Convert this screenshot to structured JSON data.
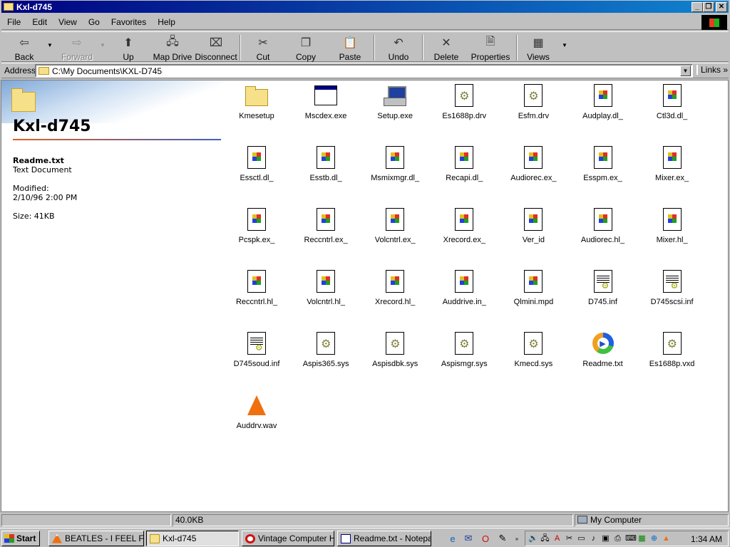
{
  "window": {
    "title": "Kxl-d745"
  },
  "menu": [
    {
      "label": "File",
      "key": "F"
    },
    {
      "label": "Edit",
      "key": "E"
    },
    {
      "label": "View",
      "key": "V"
    },
    {
      "label": "Go",
      "key": "G"
    },
    {
      "label": "Favorites",
      "key": "a"
    },
    {
      "label": "Help",
      "key": "H"
    }
  ],
  "toolbar": {
    "back": "Back",
    "forward": "Forward",
    "up": "Up",
    "map_drive": "Map Drive",
    "disconnect": "Disconnect",
    "cut": "Cut",
    "copy": "Copy",
    "paste": "Paste",
    "undo": "Undo",
    "delete": "Delete",
    "properties": "Properties",
    "views": "Views"
  },
  "address": {
    "label": "Address",
    "value": "C:\\My Documents\\KXL-D745",
    "links": "Links"
  },
  "sidebar": {
    "folder_title": "Kxl-d745",
    "file_name": "Readme.txt",
    "file_type": "Text Document",
    "modified_label": "Modified:",
    "modified_value": "2/10/96 2:00 PM",
    "size": "Size: 41KB"
  },
  "files": [
    {
      "name": "Kmesetup",
      "icon": "folder-icon"
    },
    {
      "name": "Mscdex.exe",
      "icon": "exe-window-icon"
    },
    {
      "name": "Setup.exe",
      "icon": "setup-computer-icon"
    },
    {
      "name": "Es1688p.drv",
      "icon": "system-file-icon"
    },
    {
      "name": "Esfm.drv",
      "icon": "system-file-icon"
    },
    {
      "name": "Audplay.dl_",
      "icon": "windows-file-icon"
    },
    {
      "name": "Ctl3d.dl_",
      "icon": "windows-file-icon"
    },
    {
      "name": "Essctl.dl_",
      "icon": "windows-file-icon"
    },
    {
      "name": "Esstb.dl_",
      "icon": "windows-file-icon"
    },
    {
      "name": "Msmixmgr.dl_",
      "icon": "windows-file-icon"
    },
    {
      "name": "Recapi.dl_",
      "icon": "windows-file-icon"
    },
    {
      "name": "Audiorec.ex_",
      "icon": "windows-file-icon"
    },
    {
      "name": "Esspm.ex_",
      "icon": "windows-file-icon"
    },
    {
      "name": "Mixer.ex_",
      "icon": "windows-file-icon"
    },
    {
      "name": "Pcspk.ex_",
      "icon": "windows-file-icon"
    },
    {
      "name": "Reccntrl.ex_",
      "icon": "windows-file-icon"
    },
    {
      "name": "Volcntrl.ex_",
      "icon": "windows-file-icon"
    },
    {
      "name": "Xrecord.ex_",
      "icon": "windows-file-icon"
    },
    {
      "name": "Ver_id",
      "icon": "windows-file-icon"
    },
    {
      "name": "Audiorec.hl_",
      "icon": "windows-file-icon"
    },
    {
      "name": "Mixer.hl_",
      "icon": "windows-file-icon"
    },
    {
      "name": "Reccntrl.hl_",
      "icon": "windows-file-icon"
    },
    {
      "name": "Volcntrl.hl_",
      "icon": "windows-file-icon"
    },
    {
      "name": "Xrecord.hl_",
      "icon": "windows-file-icon"
    },
    {
      "name": "Auddrive.in_",
      "icon": "windows-file-icon"
    },
    {
      "name": "Qlmini.mpd",
      "icon": "windows-file-icon"
    },
    {
      "name": "D745.inf",
      "icon": "setup-info-icon"
    },
    {
      "name": "D745scsi.inf",
      "icon": "setup-info-icon"
    },
    {
      "name": "D745soud.inf",
      "icon": "setup-info-icon"
    },
    {
      "name": "Aspis365.sys",
      "icon": "system-file-icon"
    },
    {
      "name": "Aspisdbk.sys",
      "icon": "system-file-icon"
    },
    {
      "name": "Aspismgr.sys",
      "icon": "system-file-icon"
    },
    {
      "name": "Kmecd.sys",
      "icon": "system-file-icon"
    },
    {
      "name": "Readme.txt",
      "icon": "media-player-icon"
    },
    {
      "name": "Es1688p.vxd",
      "icon": "system-file-icon"
    },
    {
      "name": "Auddrv.wav",
      "icon": "vlc-cone-icon"
    }
  ],
  "status": {
    "size": "40.0KB",
    "zone": "My Computer"
  },
  "taskbar": {
    "start": "Start",
    "tasks": [
      {
        "label": "BEATLES - I FEEL F...",
        "icon": "vlc-cone-icon"
      },
      {
        "label": "Kxl-d745",
        "icon": "folder-icon"
      },
      {
        "label": "Vintage Computer H...",
        "icon": "opera-icon"
      },
      {
        "label": "Readme.txt - Notepad",
        "icon": "notepad-icon"
      }
    ],
    "clock": "1:34 AM"
  },
  "colors": {
    "title_start": "#000080",
    "title_end": "#1084d0",
    "face": "#c0c0c0"
  }
}
